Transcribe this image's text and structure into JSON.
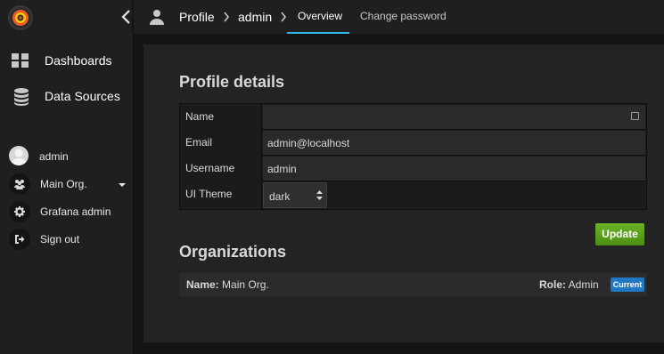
{
  "colors": {
    "accent_tab": "#33b5e5",
    "update_button": "#56a118",
    "badge": "#1f78c1",
    "background": "#141414",
    "panel": "#232325"
  },
  "sidebar": {
    "logo_icon": "grafana-logo-icon",
    "items": [
      {
        "label": "Dashboards",
        "icon": "dashboards-grid-icon"
      },
      {
        "label": "Data Sources",
        "icon": "database-icon"
      }
    ],
    "user": {
      "label": "admin",
      "icon": "avatar"
    },
    "sub_items": [
      {
        "label": "Main Org.",
        "icon": "users-icon",
        "has_dropdown": true
      },
      {
        "label": "Grafana admin",
        "icon": "gear-icon"
      },
      {
        "label": "Sign out",
        "icon": "sign-out-icon"
      }
    ]
  },
  "navbar": {
    "collapse_icon": "chevron-left-icon",
    "breadcrumb": [
      {
        "label": "Profile",
        "icon": "user-icon"
      },
      {
        "label": "admin"
      }
    ],
    "tabs": [
      {
        "label": "Overview",
        "active": true
      },
      {
        "label": "Change password",
        "active": false
      }
    ]
  },
  "profile": {
    "title": "Profile details",
    "fields": [
      {
        "label": "Name",
        "value": "",
        "icon": "keyboard-icon"
      },
      {
        "label": "Email",
        "value": "admin@localhost"
      },
      {
        "label": "Username",
        "value": "admin"
      },
      {
        "label": "UI Theme",
        "value": "dark",
        "type": "select"
      }
    ],
    "update_button": "Update"
  },
  "organizations": {
    "title": "Organizations",
    "rows": [
      {
        "name_label": "Name:",
        "name": "Main Org.",
        "role_label": "Role:",
        "role": "Admin",
        "badge": "Current"
      }
    ]
  }
}
